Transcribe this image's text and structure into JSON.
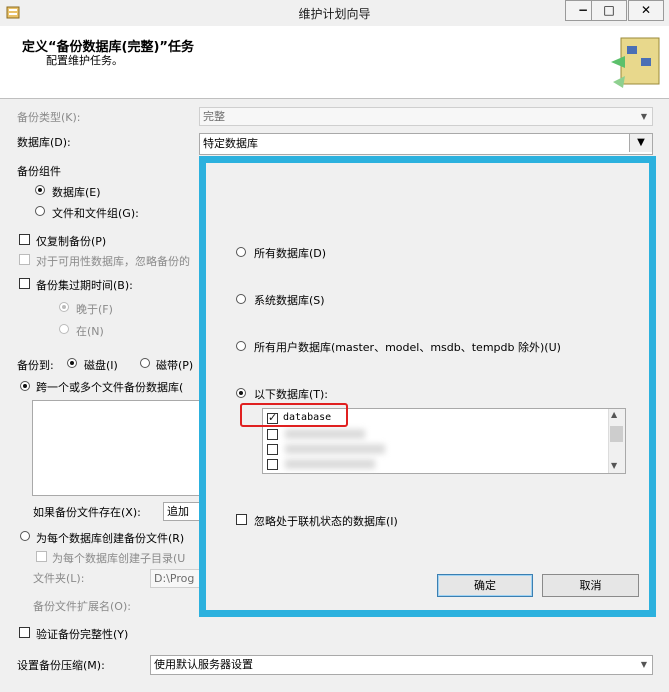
{
  "window": {
    "title": "维护计划向导",
    "minimize": "−",
    "maximize": "□",
    "close": "✕"
  },
  "header": {
    "title": "定义“备份数据库(完整)”任务",
    "subtitle": "配置维护任务。"
  },
  "form": {
    "backup_type_label": "备份类型(K):",
    "backup_type_value": "完整",
    "database_label": "数据库(D):",
    "database_value": "特定数据库",
    "backup_component_label": "备份组件",
    "component_database": "数据库(E)",
    "component_files": "文件和文件组(G):",
    "copy_only": "仅复制备份(P)",
    "availability_db": "对于可用性数据库，忽略备份的",
    "backup_set_expire": "备份集过期时间(B):",
    "later": "晚于(F)",
    "on": "在(N)",
    "backup_to_label": "备份到:",
    "disk": "磁盘(I)",
    "tape": "磁带(P)",
    "span_files": "跨一个或多个文件备份数据库(",
    "if_exists_label": "如果备份文件存在(X):",
    "if_exists_value": "追加",
    "create_per_db": "为每个数据库创建备份文件(R)",
    "create_subdir": "为每个数据库创建子目录(U",
    "folder_label": "文件夹(L):",
    "folder_value": "D:\\Prog",
    "ext_label": "备份文件扩展名(O):",
    "verify": "验证备份完整性(Y)",
    "compression_label": "设置备份压缩(M):",
    "compression_value": "使用默认服务器设置"
  },
  "popup": {
    "all_databases": "所有数据库(D)",
    "system_databases": "系统数据库(S)",
    "all_user_databases": "所有用户数据库(master、model、msdb、tempdb 除外)(U)",
    "these_databases": "以下数据库(T):",
    "db_items": [
      "database"
    ],
    "ignore_offline": "忽略处于联机状态的数据库(I)",
    "ok": "确定",
    "cancel": "取消"
  },
  "colors": {
    "popup_border": "#2cb1de",
    "highlight": "#e02020"
  }
}
